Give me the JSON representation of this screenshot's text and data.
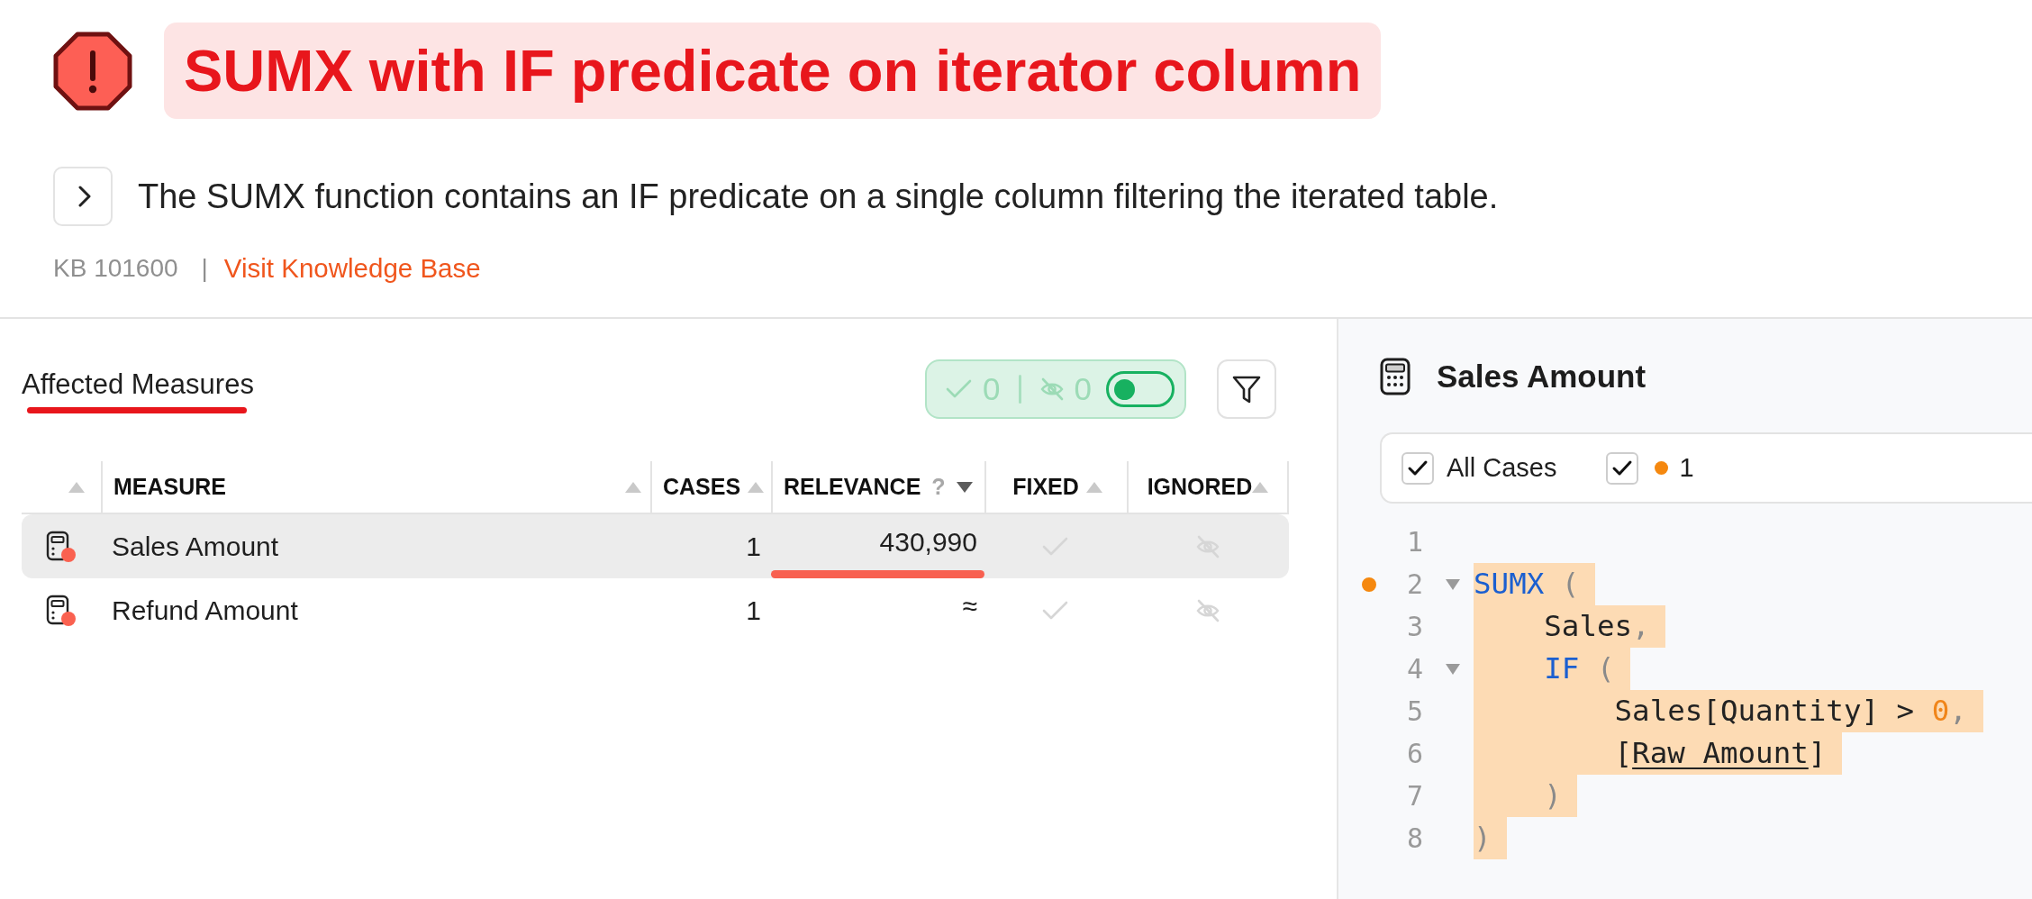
{
  "issue": {
    "title": "SUMX with IF predicate on iterator column",
    "expanded": false,
    "description": "The SUMX function contains an IF predicate on a single column filtering the iterated table.",
    "kb_id": "KB 101600",
    "separator": "|",
    "kb_link": "Visit Knowledge Base"
  },
  "measures_panel": {
    "tabs": [
      {
        "label": "Affected Measures",
        "selected": true
      }
    ],
    "fixed_count": "0",
    "ignored_count": "0",
    "toggle_on": false
  },
  "table": {
    "columns": [
      {
        "selected": false
      },
      {
        "label": "MEASURE",
        "selected": false
      },
      {
        "label": "CASES",
        "selected": false
      },
      {
        "label": "RELEVANCE",
        "help": "?",
        "selected": true
      },
      {
        "label": "FIXED",
        "selected": false
      },
      {
        "label": "IGNORED",
        "selected": false
      }
    ],
    "rows": [
      {
        "measure": "Sales Amount",
        "cases": "1",
        "relevance": "430,990",
        "fixed": false,
        "ignored": false,
        "selected": true
      },
      {
        "measure": "Refund Amount",
        "cases": "1",
        "relevance": "≈",
        "fixed": false,
        "ignored": false,
        "selected": false
      }
    ]
  },
  "detail": {
    "title": "Sales Amount",
    "filters": [
      {
        "label": "All Cases",
        "checked": true
      },
      {
        "label": "1",
        "checked": true,
        "color": "#f5880f"
      }
    ],
    "code": [
      {
        "number": "1",
        "marker": false,
        "foldable": false,
        "highlighted": false
      },
      {
        "number": "2",
        "marker": true,
        "foldable": true,
        "highlighted": true,
        "tokens": [
          {
            "kind": "keyword",
            "text": "SUMX"
          },
          {
            "kind": "punct",
            "text": " ("
          }
        ]
      },
      {
        "number": "3",
        "marker": false,
        "foldable": false,
        "highlighted": true,
        "tokens": [
          {
            "kind": "plain",
            "text": "    Sales"
          },
          {
            "kind": "punct",
            "text": ","
          }
        ]
      },
      {
        "number": "4",
        "marker": false,
        "foldable": true,
        "highlighted": true,
        "tokens": [
          {
            "kind": "keyword",
            "text": "    IF"
          },
          {
            "kind": "punct",
            "text": " ("
          }
        ]
      },
      {
        "number": "5",
        "marker": false,
        "foldable": false,
        "highlighted": true,
        "tokens": [
          {
            "kind": "plain",
            "text": "        Sales[Quantity] > "
          },
          {
            "kind": "number",
            "text": "0"
          },
          {
            "kind": "punct",
            "text": ","
          }
        ]
      },
      {
        "number": "6",
        "marker": false,
        "foldable": false,
        "highlighted": true,
        "tokens": [
          {
            "kind": "plain",
            "text": "        ["
          },
          {
            "kind": "reference",
            "text": "Raw Amount"
          },
          {
            "kind": "plain",
            "text": "]"
          }
        ]
      },
      {
        "number": "7",
        "marker": false,
        "foldable": false,
        "highlighted": true,
        "tokens": [
          {
            "kind": "punct",
            "text": "    )"
          }
        ]
      },
      {
        "number": "8",
        "marker": false,
        "foldable": false,
        "highlighted": true,
        "tokens": [
          {
            "kind": "punct",
            "text": ")"
          }
        ]
      }
    ]
  }
}
